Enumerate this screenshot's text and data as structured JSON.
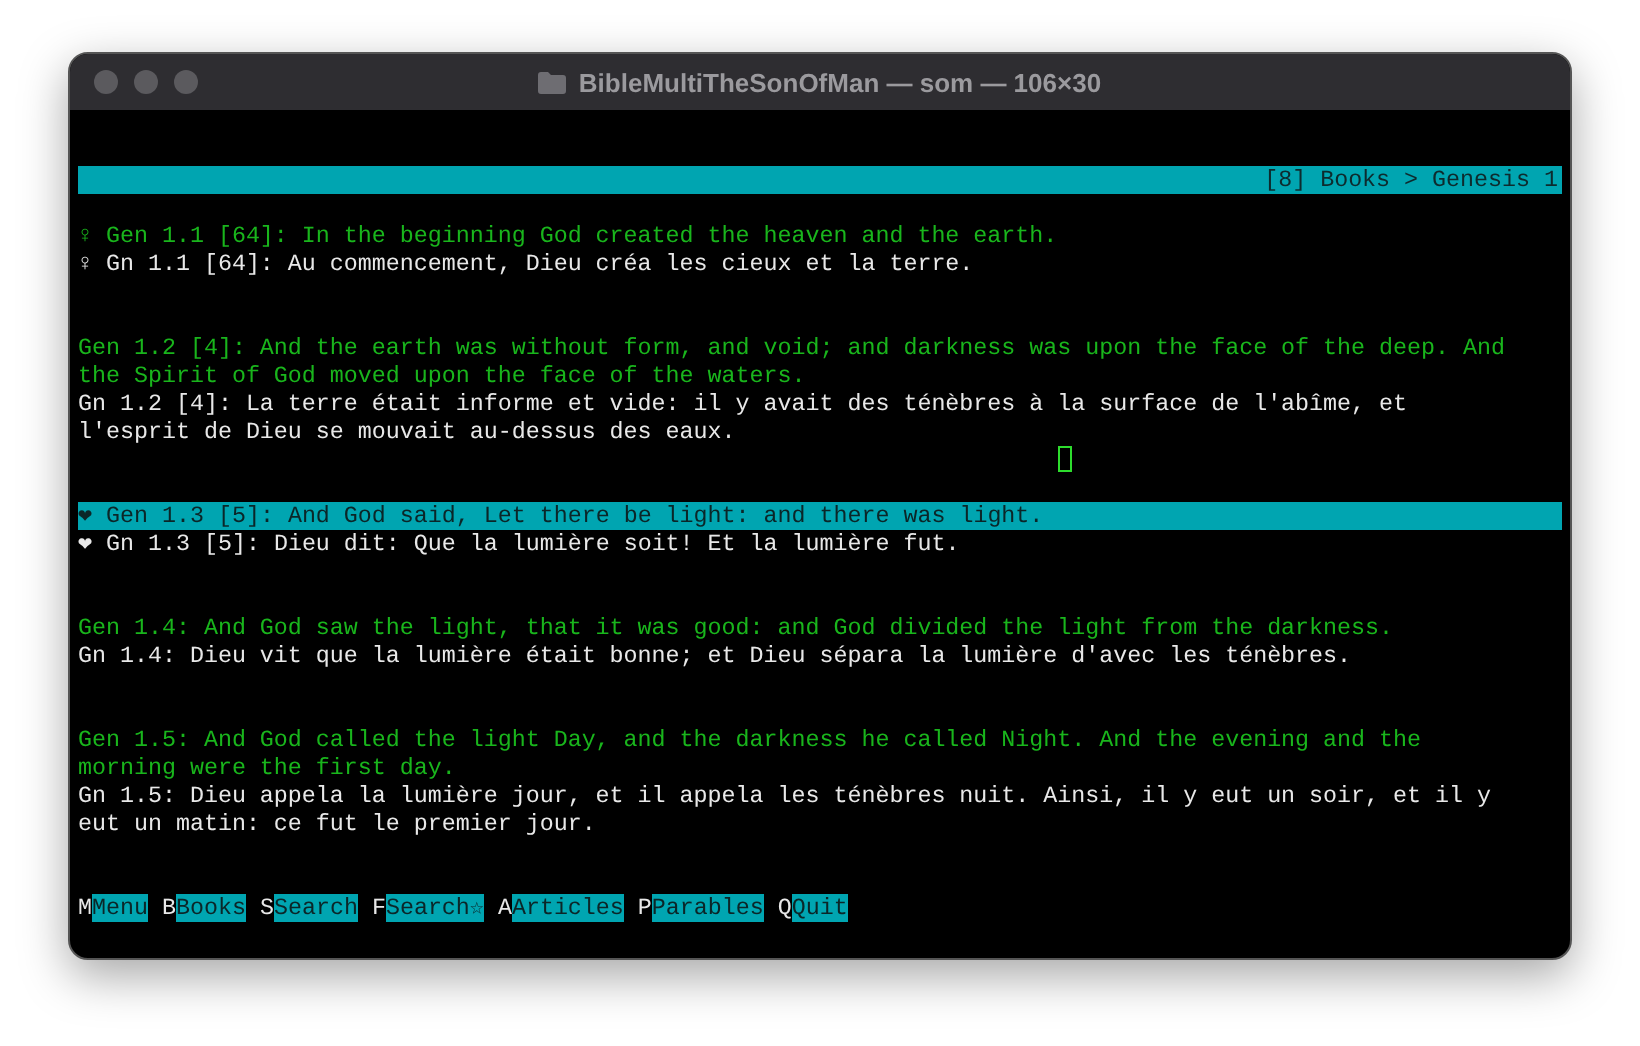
{
  "window": {
    "title": "BibleMultiTheSonOfMan — som — 106×30"
  },
  "breadcrumb": "[8] Books > Genesis 1",
  "verses": [
    {
      "selected": false,
      "primary": [
        "♀ Gen 1.1 [64]: In the beginning God created the heaven and the earth."
      ],
      "secondary": [
        "♀ Gn 1.1 [64]: Au commencement, Dieu créa les cieux et la terre."
      ]
    },
    {
      "selected": false,
      "primary": [
        "Gen 1.2 [4]: And the earth was without form, and void; and darkness was upon the face of the deep. And",
        "the Spirit of God moved upon the face of the waters."
      ],
      "secondary": [
        "Gn 1.2 [4]: La terre était informe et vide: il y avait des ténèbres à la surface de l'abîme, et",
        "l'esprit de Dieu se mouvait au-dessus des eaux."
      ],
      "cursor_after": true
    },
    {
      "selected": true,
      "primary": [
        "❤ Gen 1.3 [5]: And God said, Let there be light: and there was light."
      ],
      "secondary": [
        "❤ Gn 1.3 [5]: Dieu dit: Que la lumière soit! Et la lumière fut."
      ]
    },
    {
      "selected": false,
      "primary": [
        "Gen 1.4: And God saw the light, that it was good: and God divided the light from the darkness."
      ],
      "secondary": [
        "Gn 1.4: Dieu vit que la lumière était bonne; et Dieu sépara la lumière d'avec les ténèbres."
      ]
    },
    {
      "selected": false,
      "primary": [
        "Gen 1.5: And God called the light Day, and the darkness he called Night. And the evening and the",
        "morning were the first day."
      ],
      "secondary": [
        "Gn 1.5: Dieu appela la lumière jour, et il appela les ténèbres nuit. Ainsi, il y eut un soir, et il y",
        "eut un matin: ce fut le premier jour."
      ]
    }
  ],
  "menu": [
    {
      "key": "M",
      "label": "Menu"
    },
    {
      "key": "B",
      "label": "Books"
    },
    {
      "key": "S",
      "label": "Search"
    },
    {
      "key": "F",
      "label": "Search☆"
    },
    {
      "key": "A",
      "label": "Articles"
    },
    {
      "key": "P",
      "label": "Parables"
    },
    {
      "key": "Q",
      "label": "Quit"
    }
  ]
}
